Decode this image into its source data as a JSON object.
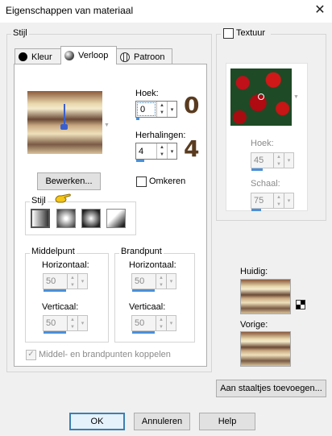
{
  "window": {
    "title": "Eigenschappen van materiaal",
    "close": "✕"
  },
  "stijl_group": {
    "label": "Stijl"
  },
  "tabs": [
    {
      "label": "Kleur"
    },
    {
      "label": "Verloop"
    },
    {
      "label": "Patroon"
    }
  ],
  "gradient": {
    "hoek_label": "Hoek:",
    "hoek_value": "0",
    "hoek_annotation": "0",
    "herhalingen_label": "Herhalingen:",
    "herhalingen_value": "4",
    "herhalingen_annotation": "4",
    "bewerken": "Bewerken...",
    "omkeren": "Omkeren",
    "stijl_label": "Stijl",
    "styles": [
      "linear-style",
      "rectangular-style",
      "radial-style",
      "sunburst-style"
    ]
  },
  "middelpunt": {
    "label": "Middelpunt",
    "horizontaal_label": "Horizontaal:",
    "horizontaal_value": "50",
    "verticaal_label": "Verticaal:",
    "verticaal_value": "50"
  },
  "brandpunt": {
    "label": "Brandpunt",
    "horizontaal_label": "Horizontaal:",
    "horizontaal_value": "50",
    "verticaal_label": "Verticaal:",
    "verticaal_value": "50"
  },
  "koppelen": "Middel- en brandpunten koppelen",
  "textuur": {
    "label": "Textuur",
    "hoek_label": "Hoek:",
    "hoek_value": "45",
    "schaal_label": "Schaal:",
    "schaal_value": "75"
  },
  "huidig_label": "Huidig:",
  "vorige_label": "Vorige:",
  "aan_staaltjes": "Aan staaltjes toevoegen...",
  "buttons": {
    "ok": "OK",
    "annuleren": "Annuleren",
    "help": "Help"
  },
  "colors": {
    "accent": "#3c7fb1",
    "bar": "#4a90d9",
    "annotation": "#5a3b1f"
  }
}
